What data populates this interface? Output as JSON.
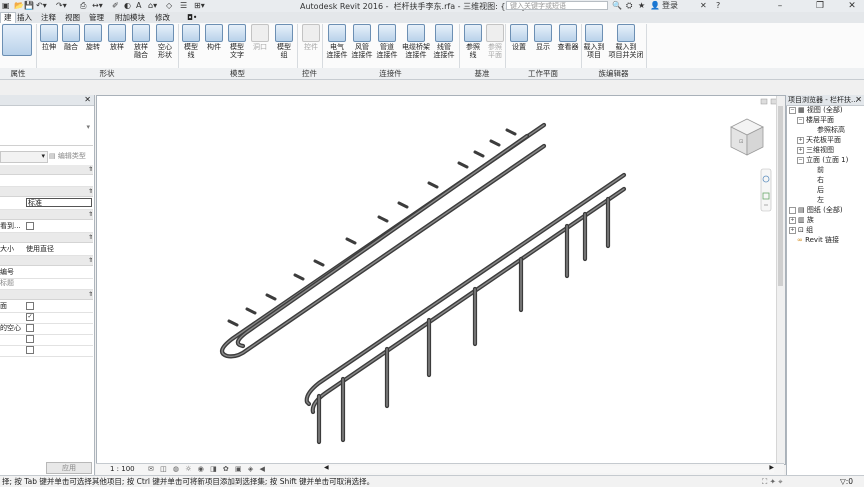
{
  "window": {
    "app_title": "Autodesk Revit 2016 -",
    "doc_title": "栏杆扶手李东.rfa - 三维视图: {三维}",
    "search_placeholder": "键入关键字或短语",
    "login": "登录",
    "minimize": "–",
    "restore": "❐",
    "close": "✕",
    "help": "?"
  },
  "tabs": [
    {
      "label": "建"
    },
    {
      "label": "插入"
    },
    {
      "label": "注释"
    },
    {
      "label": "视图"
    },
    {
      "label": "管理"
    },
    {
      "label": "附加模块"
    },
    {
      "label": "修改"
    },
    {
      "label": "◘•"
    }
  ],
  "ribbon": {
    "buttons": [
      {
        "label": "拉伸"
      },
      {
        "label": "融合"
      },
      {
        "label": "旋转"
      },
      {
        "label": "放样"
      },
      {
        "label": "放样\n融合"
      },
      {
        "label": "空心\n形状"
      },
      {
        "label": "模型\n线"
      },
      {
        "label": "构件"
      },
      {
        "label": "模型\n文字"
      },
      {
        "label": "洞口"
      },
      {
        "label": "模型\n组"
      },
      {
        "label": "控件"
      },
      {
        "label": "电气\n连接件"
      },
      {
        "label": "风管\n连接件"
      },
      {
        "label": "管道\n连接件"
      },
      {
        "label": "电缆桥架\n连接件"
      },
      {
        "label": "线管\n连接件"
      },
      {
        "label": "参照\n线"
      },
      {
        "label": "参照\n平面"
      },
      {
        "label": "设置"
      },
      {
        "label": "显示"
      },
      {
        "label": "查看器"
      },
      {
        "label": "载入到\n项目"
      },
      {
        "label": "载入到\n项目并关闭"
      }
    ],
    "panels": [
      {
        "label": "属性"
      },
      {
        "label": "形状"
      },
      {
        "label": "模型"
      },
      {
        "label": "控件"
      },
      {
        "label": "连接件"
      },
      {
        "label": "基准"
      },
      {
        "label": "工作平面"
      },
      {
        "label": "族编辑器"
      }
    ]
  },
  "properties": {
    "close": "✕",
    "edit_type": "编辑类型",
    "rows": [
      {
        "k": "",
        "v": "标准"
      },
      {
        "k": "看到...",
        "v": ""
      },
      {
        "k": "大小",
        "v": "使用直径"
      },
      {
        "k": "编号",
        "v": ""
      },
      {
        "k": "标题",
        "v": ""
      },
      {
        "k": "面",
        "v": ""
      },
      {
        "k": "",
        "v": ""
      },
      {
        "k": "的空心",
        "v": ""
      },
      {
        "k": "",
        "v": ""
      },
      {
        "k": "",
        "v": ""
      }
    ],
    "apply": "应用"
  },
  "browser": {
    "title": "项目浏览器 - 栏杆扶...",
    "close": "✕",
    "items": [
      {
        "label": "视图 (全部)"
      },
      {
        "label": "楼层平面"
      },
      {
        "label": "参照标高"
      },
      {
        "label": "天花板平面"
      },
      {
        "label": "三维视图"
      },
      {
        "label": "立面 (立面 1)"
      },
      {
        "label": "前"
      },
      {
        "label": "右"
      },
      {
        "label": "后"
      },
      {
        "label": "左"
      },
      {
        "label": "图纸 (全部)"
      },
      {
        "label": "族"
      },
      {
        "label": "组"
      },
      {
        "label": "Revit 链接"
      }
    ]
  },
  "viewbar": {
    "scale": "1 : 100"
  },
  "status": {
    "text": "择; 按 Tab 键并单击可选择其他项目; 按 Ctrl 键并单击可将新项目添加到选择集; 按 Shift 键并单击可取消选择。",
    "filter": ":0"
  },
  "colors": {
    "ribbon_bg": "#fbfbfb",
    "canvas_bg": "#ffffff",
    "rail": "#3c3c3c"
  }
}
